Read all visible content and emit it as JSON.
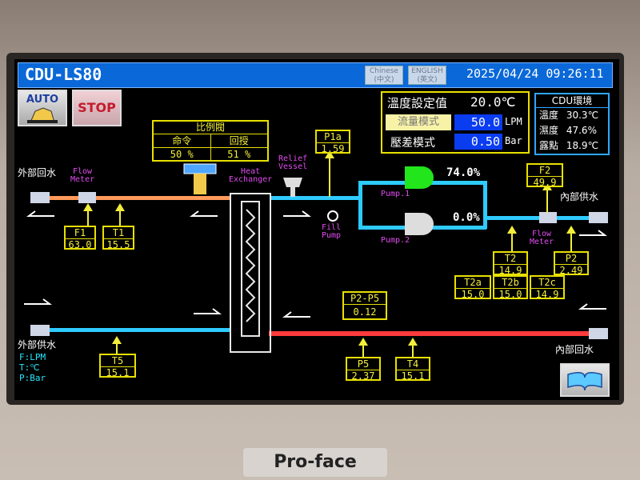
{
  "app": {
    "title": "CDU-LS80",
    "datetime": "2025/04/24 09:26:11",
    "brand": "Pro-face"
  },
  "lang": {
    "chinese": [
      "Chinese",
      "(中文)"
    ],
    "english": [
      "ENGLISH",
      "(英文)"
    ]
  },
  "buttons": {
    "auto": "AUTO",
    "stop": "STOP"
  },
  "settings": {
    "temp_label": "溫度設定值",
    "temp_value": "20.0℃",
    "flow_label": "流量模式",
    "flow_value": "50.0",
    "flow_unit": "LPM",
    "pressure_label": "壓差模式",
    "pressure_value": "0.50",
    "pressure_unit": "Bar"
  },
  "env": {
    "title": "CDU環境",
    "temp_label": "溫度",
    "temp_value": "30.3℃",
    "humidity_label": "濕度",
    "humidity_value": "47.6%",
    "dew_label": "露點",
    "dew_value": "18.9℃"
  },
  "valve": {
    "title": "比例閥",
    "cmd_label": "命令",
    "fb_label": "回授",
    "cmd_value": "50 %",
    "fb_value": "51 %"
  },
  "labels": {
    "external_return": "外部回水",
    "external_supply": "外部供水",
    "internal_supply": "內部供水",
    "internal_return": "內部回水",
    "heat_exchanger": [
      "Heat",
      "Exchanger"
    ],
    "relief_vessel": [
      "Relief",
      "Vessel"
    ],
    "fill_pump": [
      "Fill",
      "Pump"
    ],
    "flow_meter": [
      "Flow",
      "Meter"
    ],
    "pump1": "Pump.1",
    "pump2": "Pump.2"
  },
  "units_note": [
    "F:LPM",
    "T:℃",
    "P:Bar"
  ],
  "sensors": {
    "F1": {
      "name": "F1",
      "value": "63.0"
    },
    "T1": {
      "name": "T1",
      "value": "15.5"
    },
    "P1a": {
      "name": "P1a",
      "value": "1.59"
    },
    "F2": {
      "name": "F2",
      "value": "49.9"
    },
    "T2": {
      "name": "T2",
      "value": "14.9"
    },
    "P2": {
      "name": "P2",
      "value": "2.49"
    },
    "T2a": {
      "name": "T2a",
      "value": "15.0"
    },
    "T2b": {
      "name": "T2b",
      "value": "15.0"
    },
    "T2c": {
      "name": "T2c",
      "value": "14.9"
    },
    "P2P5": {
      "name": "P2-P5",
      "value": "0.12"
    },
    "T5": {
      "name": "T5",
      "value": "15.1"
    },
    "P5": {
      "name": "P5",
      "value": "2.37"
    },
    "T4": {
      "name": "T4",
      "value": "15.1"
    }
  },
  "pump_speed": {
    "pump1": "74.0%",
    "pump2": "0.0%"
  },
  "colors": {
    "accent_blue": "#0a68d8",
    "pipe_cold": "#2ecbff",
    "pipe_hot": "#ff3b3b",
    "pipe_orange": "#ff9a5c",
    "label_yellow": "#f3ee3a",
    "pump_running": "#22e51c"
  }
}
